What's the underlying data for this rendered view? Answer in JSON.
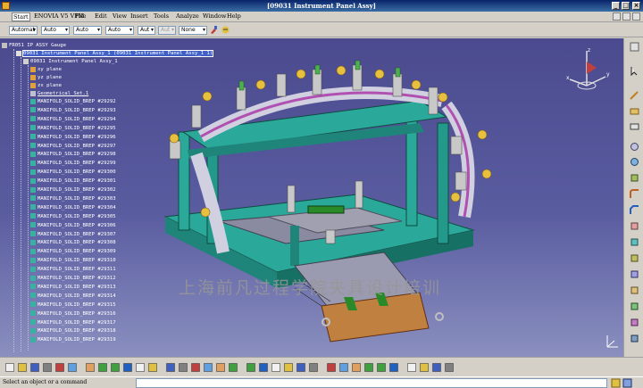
{
  "window": {
    "title": "[09031 Instrument Panel Assy]",
    "controls": [
      "_",
      "□",
      "×"
    ]
  },
  "menu": {
    "items": [
      "Start",
      "ENOVIA V5 VPM",
      "File",
      "Edit",
      "View",
      "Insert",
      "Tools",
      "Analyze",
      "Window",
      "Help"
    ]
  },
  "selectors": {
    "s1": "Automat",
    "s2": "Auto",
    "s3": "Auto",
    "s4": "Auto",
    "s5": "Aut",
    "s6": "Aut",
    "s7": "None"
  },
  "tree": {
    "root": "FR051 IP ASSY Gauge",
    "product": "09031 Instrument Panel Assy_1 (09031 Instrument Panel Assy_1 1)",
    "part": "09031 Instrument Panel Assy_1",
    "planes": [
      "xy plane",
      "yz plane",
      "zx plane"
    ],
    "geoset": "Geometrical Set.1",
    "breps": [
      "MANIFOLD_SOLID_BREP #29292",
      "MANIFOLD_SOLID_BREP #29293",
      "MANIFOLD_SOLID_BREP #29294",
      "MANIFOLD_SOLID_BREP #29295",
      "MANIFOLD_SOLID_BREP #29296",
      "MANIFOLD_SOLID_BREP #29297",
      "MANIFOLD_SOLID_BREP #29298",
      "MANIFOLD_SOLID_BREP #29299",
      "MANIFOLD_SOLID_BREP #29300",
      "MANIFOLD_SOLID_BREP #29301",
      "MANIFOLD_SOLID_BREP #29302",
      "MANIFOLD_SOLID_BREP #29303",
      "MANIFOLD_SOLID_BREP #29304",
      "MANIFOLD_SOLID_BREP #29305",
      "MANIFOLD_SOLID_BREP #29306",
      "MANIFOLD_SOLID_BREP #29307",
      "MANIFOLD_SOLID_BREP #29308",
      "MANIFOLD_SOLID_BREP #29309",
      "MANIFOLD_SOLID_BREP #29310",
      "MANIFOLD_SOLID_BREP #29311",
      "MANIFOLD_SOLID_BREP #29312",
      "MANIFOLD_SOLID_BREP #29313",
      "MANIFOLD_SOLID_BREP #29314",
      "MANIFOLD_SOLID_BREP #29315",
      "MANIFOLD_SOLID_BREP #29316",
      "MANIFOLD_SOLID_BREP #29317",
      "MANIFOLD_SOLID_BREP #29318",
      "MANIFOLD_SOLID_BREP #29319"
    ]
  },
  "viewport": {
    "watermark": "上海前凡过程学院夹具设计培训"
  },
  "compass": {
    "x": "x",
    "y": "y",
    "z": "z"
  },
  "status": {
    "text": "Select an object or a command"
  },
  "colors": {
    "background_top": "#4b4a8f",
    "background_bottom": "#8a8fbf",
    "frame": "#2aa89a",
    "fixture_arms": "#d0d0d0",
    "clamps": "#e8c040",
    "wood_base": "#c08040"
  }
}
